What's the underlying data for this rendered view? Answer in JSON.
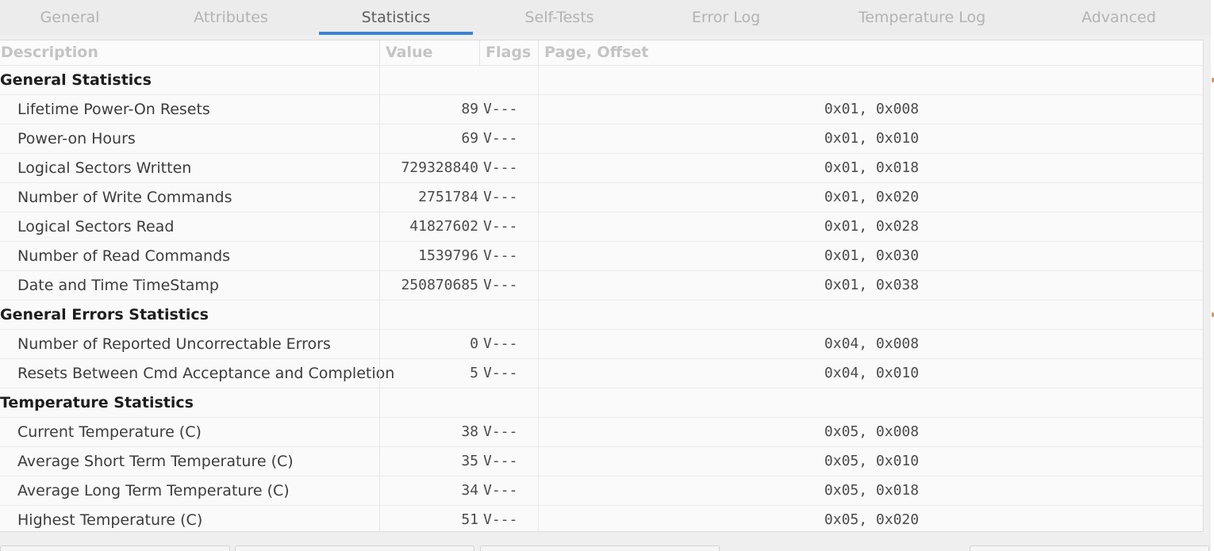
{
  "tabs": [
    {
      "label": "General",
      "active": false
    },
    {
      "label": "Attributes",
      "active": false
    },
    {
      "label": "Statistics",
      "active": true
    },
    {
      "label": "Self-Tests",
      "active": false
    },
    {
      "label": "Error Log",
      "active": false
    },
    {
      "label": "Temperature Log",
      "active": false
    },
    {
      "label": "Advanced",
      "active": false
    }
  ],
  "table": {
    "columns": [
      "Description",
      "Value",
      "Flags",
      "Page, Offset"
    ],
    "rows": [
      {
        "type": "group",
        "description": "General Statistics",
        "value": "",
        "flags": "",
        "page_offset": ""
      },
      {
        "type": "item",
        "description": "Lifetime Power-On Resets",
        "value": "89",
        "flags": "V---",
        "page_offset": "0x01, 0x008"
      },
      {
        "type": "item",
        "description": "Power-on Hours",
        "value": "69",
        "flags": "V---",
        "page_offset": "0x01, 0x010"
      },
      {
        "type": "item",
        "description": "Logical Sectors Written",
        "value": "729328840",
        "flags": "V---",
        "page_offset": "0x01, 0x018"
      },
      {
        "type": "item",
        "description": "Number of Write Commands",
        "value": "2751784",
        "flags": "V---",
        "page_offset": "0x01, 0x020"
      },
      {
        "type": "item",
        "description": "Logical Sectors Read",
        "value": "41827602",
        "flags": "V---",
        "page_offset": "0x01, 0x028"
      },
      {
        "type": "item",
        "description": "Number of Read Commands",
        "value": "1539796",
        "flags": "V---",
        "page_offset": "0x01, 0x030"
      },
      {
        "type": "item",
        "description": "Date and Time TimeStamp",
        "value": "250870685",
        "flags": "V---",
        "page_offset": "0x01, 0x038"
      },
      {
        "type": "group",
        "description": "General Errors Statistics",
        "value": "",
        "flags": "",
        "page_offset": ""
      },
      {
        "type": "item",
        "description": "Number of Reported Uncorrectable Errors",
        "value": "0",
        "flags": "V---",
        "page_offset": "0x04, 0x008"
      },
      {
        "type": "item",
        "description": "Resets Between Cmd Acceptance and Completion",
        "value": "5",
        "flags": "V---",
        "page_offset": "0x04, 0x010"
      },
      {
        "type": "group",
        "description": "Temperature Statistics",
        "value": "",
        "flags": "",
        "page_offset": ""
      },
      {
        "type": "item",
        "description": "Current Temperature (C)",
        "value": "38",
        "flags": "V---",
        "page_offset": "0x05, 0x008"
      },
      {
        "type": "item",
        "description": "Average Short Term Temperature (C)",
        "value": "35",
        "flags": "V---",
        "page_offset": "0x05, 0x010"
      },
      {
        "type": "item",
        "description": "Average Long Term Temperature (C)",
        "value": "34",
        "flags": "V---",
        "page_offset": "0x05, 0x018"
      },
      {
        "type": "item",
        "description": "Highest Temperature (C)",
        "value": "51",
        "flags": "V---",
        "page_offset": "0x05, 0x020"
      }
    ]
  },
  "colors": {
    "active_tab_indicator": "#3a83d6",
    "inactive_tab_text": "#b3b3b3",
    "active_tab_text": "#5c5c5c",
    "header_text": "#c4c4c4"
  }
}
